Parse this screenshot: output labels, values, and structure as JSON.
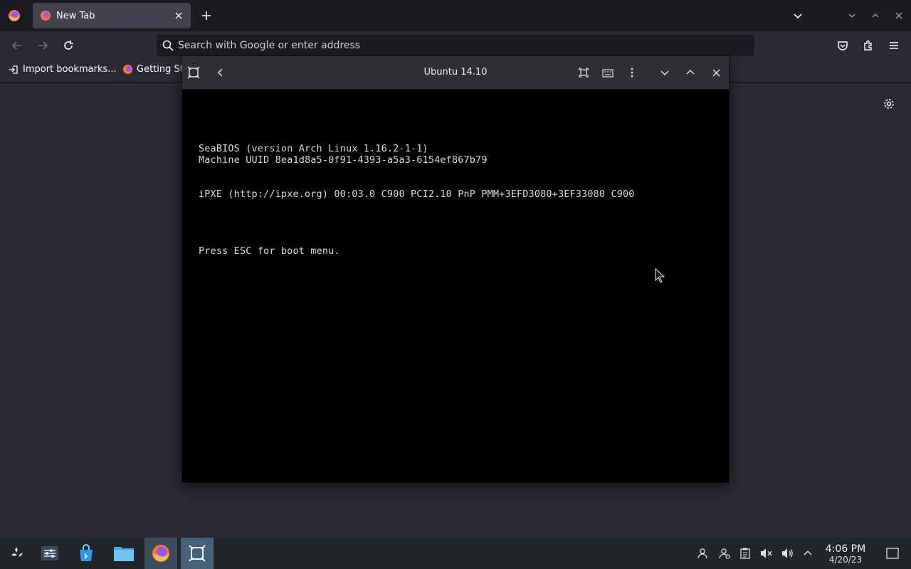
{
  "browser": {
    "tab_title": "New Tab",
    "address_placeholder": "Search with Google or enter address",
    "bookmarks": [
      {
        "label": "Import bookmarks..."
      },
      {
        "label": "Getting St"
      }
    ]
  },
  "vm_window": {
    "title": "Ubuntu 14.10",
    "console_lines": [
      "SeaBIOS (version Arch Linux 1.16.2-1-1)",
      "Machine UUID 8ea1d8a5-0f91-4393-a5a3-6154ef867b79",
      "iPXE (http://ipxe.org) 00:03.0 C900 PCI2.10 PnP PMM+3EFD3080+3EF33080 C900",
      "Press ESC for boot menu."
    ]
  },
  "taskbar": {
    "time": "4:06 PM",
    "date": "4/20/23"
  },
  "colors": {
    "browser_bg": "#2b2a33",
    "tabbar_bg": "#1c1b22",
    "taskbar_bg": "#232629",
    "active_task": "#3a4b5c"
  }
}
